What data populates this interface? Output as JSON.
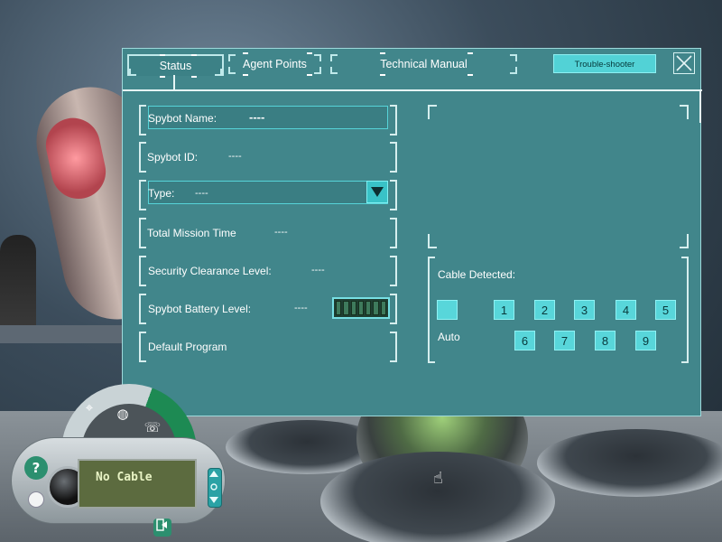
{
  "tabs": [
    {
      "label": "Status",
      "active": true
    },
    {
      "label": "Agent Points",
      "active": false
    },
    {
      "label": "Technical Manual",
      "active": false
    }
  ],
  "troubleshooter_label": "Trouble-shooter",
  "fields": {
    "name": {
      "label": "Spybot Name:",
      "value": "----"
    },
    "id": {
      "label": "Spybot ID:",
      "value": "----"
    },
    "type": {
      "label": "Type:",
      "value": "----"
    },
    "mission_time": {
      "label": "Total Mission Time",
      "value": "----"
    },
    "clearance": {
      "label": "Security Clearance Level:",
      "value": "----"
    },
    "battery": {
      "label": "Spybot Battery Level:",
      "value": "----",
      "level": 0
    },
    "program": {
      "label": "Default Program"
    }
  },
  "cable": {
    "label": "Cable Detected:",
    "auto_label": "Auto",
    "channels": [
      "1",
      "2",
      "3",
      "4",
      "5",
      "6",
      "7",
      "8",
      "9"
    ]
  },
  "device": {
    "display_text": "No Cable",
    "help_label": "?"
  },
  "colors": {
    "panel": "#41868b",
    "button": "#58d6da",
    "lcd": "#5c6b3f"
  }
}
